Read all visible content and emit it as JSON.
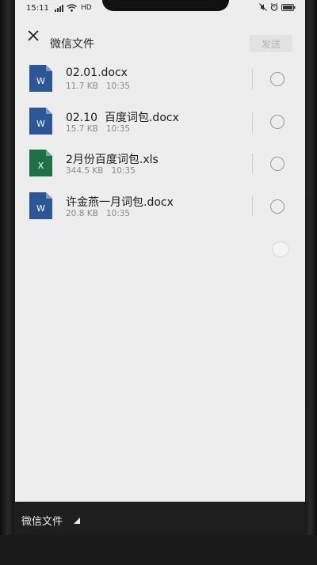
{
  "status_bar": {
    "time": "15:11",
    "network": "HD"
  },
  "header": {
    "title": "微信文件",
    "send_label": "发送"
  },
  "files": [
    {
      "name": "02.01.docx",
      "size": "11.7 KB",
      "time": "10:35",
      "type": "word",
      "icon_letter": "W",
      "icon_color": "#2b5797"
    },
    {
      "name": "02.10  百度词包.docx",
      "size": "15.7 KB",
      "time": "10:35",
      "type": "word",
      "icon_letter": "W",
      "icon_color": "#2b5797"
    },
    {
      "name": "2月份百度词包.xls",
      "size": "344.5 KB",
      "time": "10:35",
      "type": "excel",
      "icon_letter": "X",
      "icon_color": "#1e7145"
    },
    {
      "name": "许金燕一月词包.docx",
      "size": "20.8 KB",
      "time": "10:35",
      "type": "word",
      "icon_letter": "W",
      "icon_color": "#2b5797"
    }
  ],
  "bottom_bar": {
    "label": "微信文件"
  },
  "colors": {
    "screen_bg": "#ededed",
    "word_blue": "#2b5797",
    "excel_green": "#1e7145",
    "send_disabled_bg": "#e2e2e2",
    "send_disabled_text": "#b4b4b4",
    "bottom_bar_bg": "#1e1e1e"
  }
}
